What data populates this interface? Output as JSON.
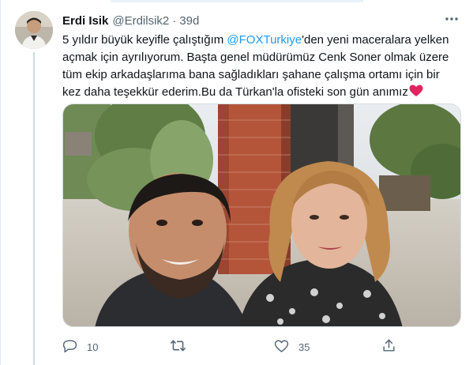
{
  "tweet": {
    "author": {
      "display_name": "Erdi Isik",
      "handle": "@Erdilsik2",
      "separator": "·",
      "time": "39d"
    },
    "text": {
      "lines": [
        [
          "5 yıldır büyük keyifle çalıştığım ",
          "@FOXTurkiye",
          "'den yeni maceralara yelken"
        ],
        "açmak için ayrılıyorum. Başta genel müdürümüz Cenk Soner olmak üzere",
        "tüm ekip arkadaşlarıma bana sağladıkları şahane çalışma ortamı için bir",
        "kez daha teşekkür ederim.Bu da Türkan'la ofisteki son gün anımız"
      ],
      "mention": "@FOXTurkiye",
      "end_emoji": "red-heart-emoji"
    },
    "media": {
      "type": "photo",
      "subject": "selfie-two-people-office-terrace"
    },
    "actions": {
      "reply_count": "10",
      "retweet_count": "",
      "like_count": "35",
      "share_count": ""
    },
    "icons": {
      "more": "more-horizontal-icon",
      "reply": "reply-icon",
      "retweet": "retweet-icon",
      "like": "like-icon",
      "share": "share-icon"
    }
  },
  "colors": {
    "text_primary": "#0f1419",
    "text_secondary": "#536471",
    "link": "#1d9bf0",
    "heart_emoji": "#e0245e",
    "divider": "#cfd9de"
  }
}
